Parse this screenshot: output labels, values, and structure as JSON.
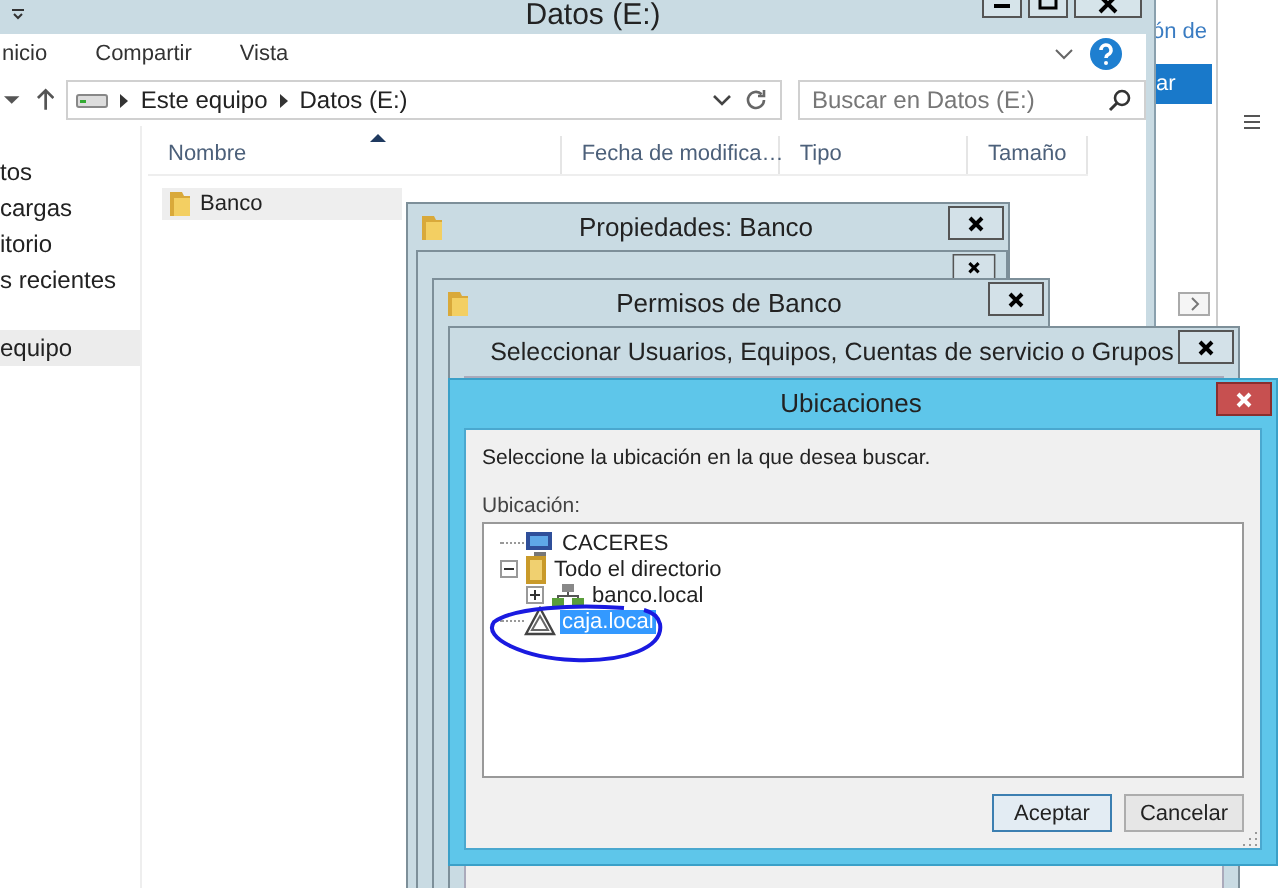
{
  "explorer": {
    "title": "Datos (E:)",
    "ribbon_tabs": [
      {
        "label": "nicio"
      },
      {
        "label": "Compartir"
      },
      {
        "label": "Vista"
      }
    ],
    "address": {
      "path": [
        "Este equipo",
        "Datos (E:)"
      ]
    },
    "search": {
      "placeholder": "Buscar en Datos (E:)"
    },
    "sidebar": {
      "items": [
        {
          "label": "tos",
          "selected": false
        },
        {
          "label": "cargas",
          "selected": false
        },
        {
          "label": "itorio",
          "selected": false
        },
        {
          "label": "s recientes",
          "selected": false
        },
        {
          "label": "equipo",
          "selected": true
        }
      ]
    },
    "table": {
      "columns": [
        "Nombre",
        "Fecha de modifica…",
        "Tipo",
        "Tamaño"
      ],
      "rows": [
        {
          "cells": [
            "Banco"
          ],
          "selected": true
        }
      ]
    }
  },
  "background_window": {
    "link": "ón de",
    "button": "ar"
  },
  "dialogs": [
    {
      "title": "Propiedades: Banco",
      "kind": "folder",
      "active": false
    },
    {
      "active": false
    },
    {
      "title": "Permisos de Banco",
      "kind": "folder",
      "active": false
    },
    {
      "title": "Seleccionar Usuarios, Equipos, Cuentas de servicio o Grupos",
      "active": false
    }
  ],
  "locations_dialog": {
    "title": "Ubicaciones",
    "active": true,
    "prompt": "Seleccione la ubicación en la que desea buscar.",
    "tree_label": "Ubicación:",
    "tree": [
      {
        "label": "CACERES",
        "kind": "computer",
        "selected": false
      },
      {
        "label": "Todo el directorio",
        "kind": "directory",
        "selected": false,
        "expanded": true,
        "children": [
          {
            "label": "banco.local",
            "kind": "domain",
            "selected": false,
            "expanded": false
          }
        ]
      },
      {
        "label": "caja.local",
        "kind": "warning",
        "selected": true
      }
    ],
    "buttons": [
      {
        "label": "Aceptar",
        "default": true
      },
      {
        "label": "Cancelar",
        "default": false
      }
    ]
  }
}
